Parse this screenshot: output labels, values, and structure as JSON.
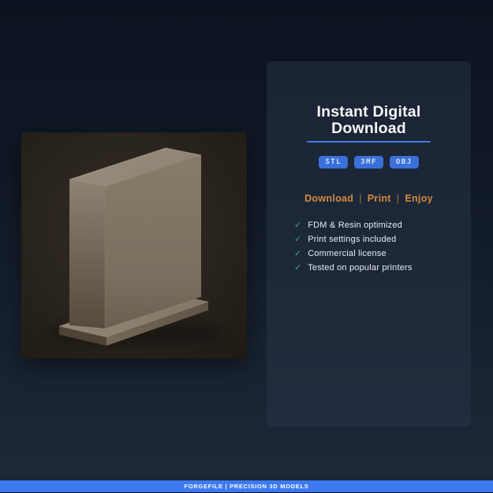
{
  "panel": {
    "title": "Instant Digital Download",
    "formats": [
      "STL",
      "3MF",
      "OBJ"
    ],
    "tagline": {
      "items": [
        "Download",
        "Print",
        "Enjoy"
      ],
      "separator": "|"
    },
    "check_glyph": "✓",
    "features": [
      "FDM & Resin optimized",
      "Print settings included",
      "Commercial license",
      "Tested on popular printers"
    ]
  },
  "product_image": {
    "alt": "Tan rectangular slab 3D model standing on a thin base plate, dark brown background"
  },
  "footer": {
    "text": "FORGEFILE | PRECISION 3D MODELS"
  },
  "colors": {
    "accent_blue": "#3d7af0",
    "badge_blue": "#3a70d9",
    "underline_blue": "#3f7de0",
    "tagline_orange": "#d28a3e",
    "check_green": "#2fb37c",
    "panel_bg": "#1d2838",
    "page_bg_top": "#0c1320",
    "page_bg_bottom": "#1d2938"
  }
}
